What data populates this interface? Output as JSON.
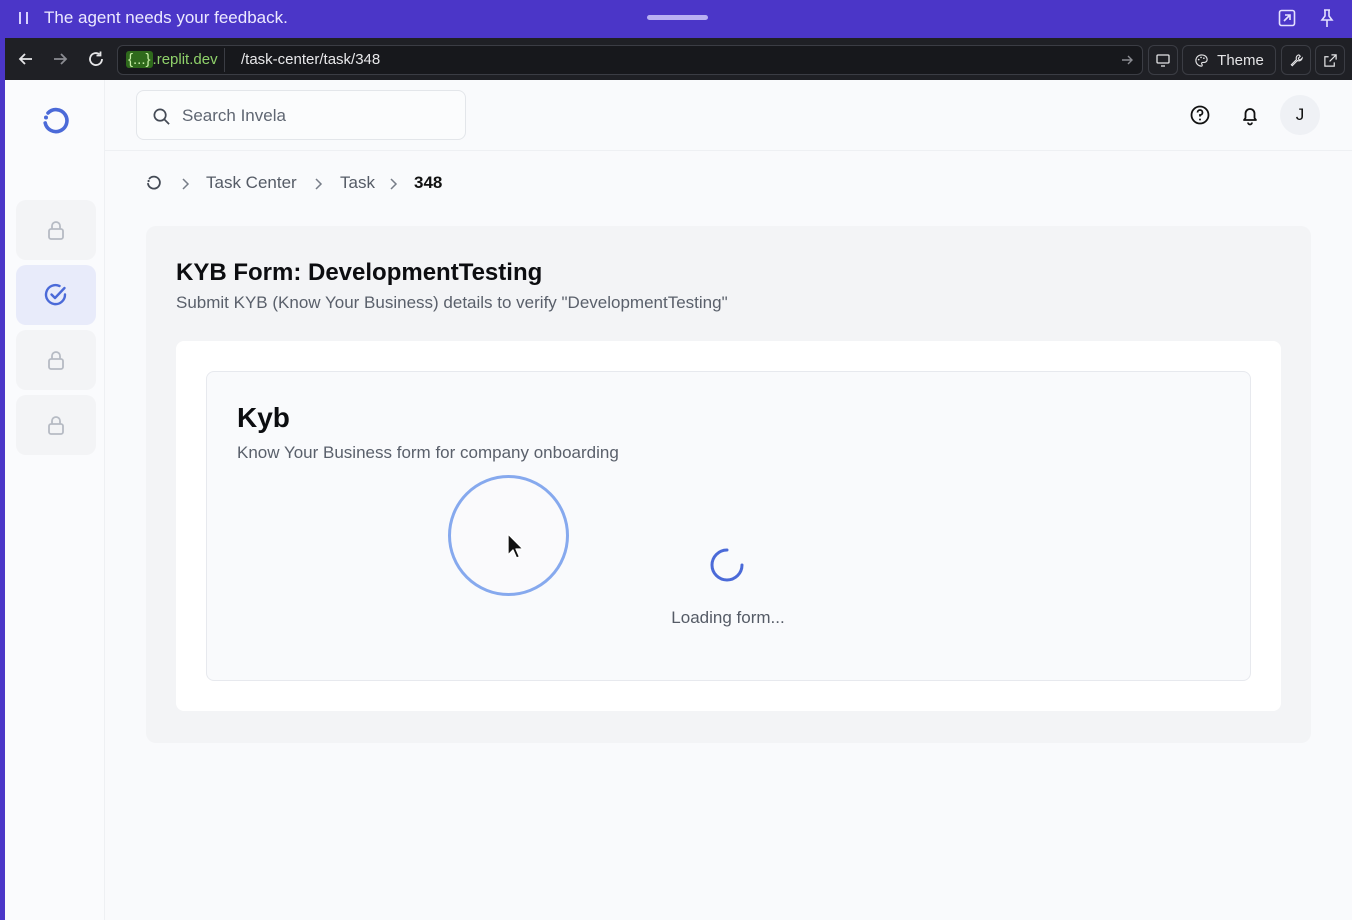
{
  "agent_bar": {
    "message": "The agent needs your feedback."
  },
  "browser": {
    "domain_highlight": "{...}",
    "domain_rest": ".replit.dev",
    "path": "/task-center/task/348",
    "theme_label": "Theme"
  },
  "search": {
    "placeholder": "Search Invela"
  },
  "user": {
    "initial": "J"
  },
  "breadcrumb": {
    "items": [
      "Task Center",
      "Task",
      "348"
    ]
  },
  "page": {
    "title": "KYB Form: DevelopmentTesting",
    "subtitle": "Submit KYB (Know Your Business) details to verify \"DevelopmentTesting\""
  },
  "form": {
    "title": "Kyb",
    "description": "Know Your Business form for company onboarding",
    "loading_text": "Loading form..."
  },
  "sidebar": {
    "items": [
      {
        "icon": "lock-icon",
        "locked": true
      },
      {
        "icon": "check-circle-icon",
        "active": true
      },
      {
        "icon": "lock-icon",
        "locked": true
      },
      {
        "icon": "lock-icon",
        "locked": true
      }
    ]
  },
  "colors": {
    "agent_bar": "#4b36c8",
    "accent": "#4a6cd9",
    "app_bg": "#f9fafc"
  }
}
